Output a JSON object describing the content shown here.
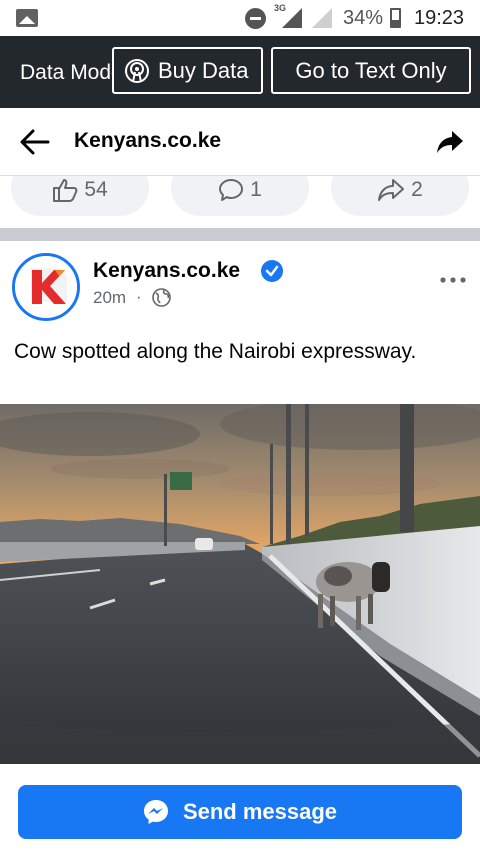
{
  "status_bar": {
    "network": "3G",
    "battery_percent": "34%",
    "time": "19:23"
  },
  "data_banner": {
    "mode_label": "Data Mode",
    "buy_data_label": "Buy Data",
    "text_only_label": "Go to Text Only"
  },
  "header": {
    "title": "Kenyans.co.ke"
  },
  "reactions": {
    "likes": "54",
    "comments": "1",
    "shares": "2"
  },
  "post": {
    "author": "Kenyans.co.ke",
    "avatar_letter": "K",
    "time": "20m",
    "separator": "·",
    "text": "Cow spotted along the Nairobi expressway.",
    "image_icon": "photo-of-cow-on-expressway"
  },
  "bottom": {
    "send_message_label": "Send message"
  },
  "colors": {
    "brand_blue": "#1877f2",
    "banner_bg": "#23282c",
    "separator_gray": "#c9ccd1",
    "logo_red": "#e42c2c"
  }
}
